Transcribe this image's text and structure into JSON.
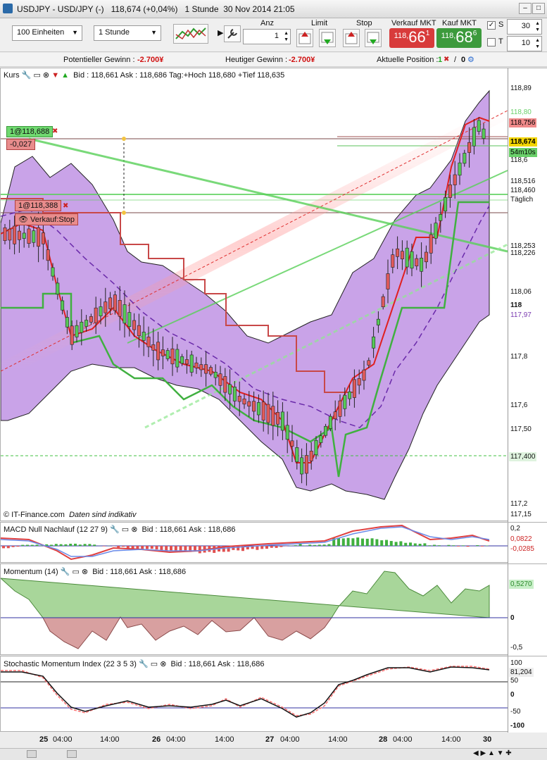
{
  "window": {
    "title": "USDJPY - USD/JPY (-)",
    "change": "118,674 (+0,04%)",
    "interval": "1 Stunde",
    "datetime": "30 Nov 2014 21:05"
  },
  "toolbar": {
    "units": "100 Einheiten",
    "timeframe": "1 Stunde",
    "anz_label": "Anz",
    "anz_value": "1",
    "limit_label": "Limit",
    "stop_label": "Stop",
    "sell_label": "Verkauf MKT",
    "sell_small": "118,",
    "sell_big": "66",
    "sell_sup": "1",
    "buy_label": "Kauf MKT",
    "buy_small": "118,",
    "buy_big": "68",
    "buy_sup": "6",
    "s_label": "S",
    "s_value": "30",
    "t_label": "T",
    "t_value": "10"
  },
  "infobar": {
    "potential_label": "Potentieller Gewinn :",
    "potential_value": "-2.700¥",
    "today_label": "Heutiger Gewinn :",
    "today_value": "-2.700¥",
    "position_label": "Aktuelle Position :",
    "position_value": "1",
    "position_zero": "0"
  },
  "colors": {
    "sell": "#e04848",
    "buy": "#3fa83f",
    "band": "#c79ee8",
    "macd_neg": "#e05050",
    "macd_pos": "#40b040"
  },
  "price_panel": {
    "header": "Kurs",
    "quote": "Bid : 118,661 Ask : 118,686 Tag:+Hoch 118,680 +Tief 118,635",
    "copyright": "© IT-Finance.com",
    "disclaimer": "Daten sind indikativ",
    "order1": "1@118,688",
    "order1_pl": "-0,027",
    "order2": "1@118,388",
    "order2_type": "Verkauf:Stop",
    "axis_ticks": [
      "118,89",
      "118,6",
      "118,4",
      "118,2",
      "118",
      "117,8",
      "117,6",
      "117,2"
    ],
    "price_tags": [
      "118,80",
      "118,756",
      "118,73",
      "118,674",
      "54m10s",
      "118,516",
      "118,460",
      "Täglich",
      "118,253",
      "118,226",
      "118,06",
      "117,97",
      "117,50",
      "117,400",
      "117,15"
    ]
  },
  "macd_panel": {
    "header": "MACD Null Nachlauf (12 27 9)",
    "quote": "Bid : 118,661 Ask : 118,686",
    "ticks": [
      "0,2",
      "0,0822",
      "-0,0285"
    ]
  },
  "momentum_panel": {
    "header": "Momentum (14)",
    "quote": "Bid : 118,661 Ask : 118,686",
    "ticks": [
      "0,5270",
      "0",
      "-0,5"
    ]
  },
  "smi_panel": {
    "header": "Stochastic Momentum Index (22 3 5 3)",
    "quote": "Bid : 118,661 Ask : 118,686",
    "ticks": [
      "100",
      "81,204",
      "50",
      "0",
      "-50",
      "-100"
    ]
  },
  "x_axis": [
    "25",
    "04:00",
    "14:00",
    "26",
    "04:00",
    "14:00",
    "27",
    "04:00",
    "14:00",
    "28",
    "04:00",
    "14:00",
    "30"
  ],
  "chart_data": {
    "type": "line",
    "title": "USDJPY - USD/JPY",
    "x": [
      "25",
      "26",
      "27",
      "28",
      "30"
    ],
    "series": [
      {
        "values": [
          118.3,
          117.85,
          117.35,
          118.25,
          118.674
        ]
      }
    ],
    "ylim": [
      117.15,
      118.89
    ]
  }
}
